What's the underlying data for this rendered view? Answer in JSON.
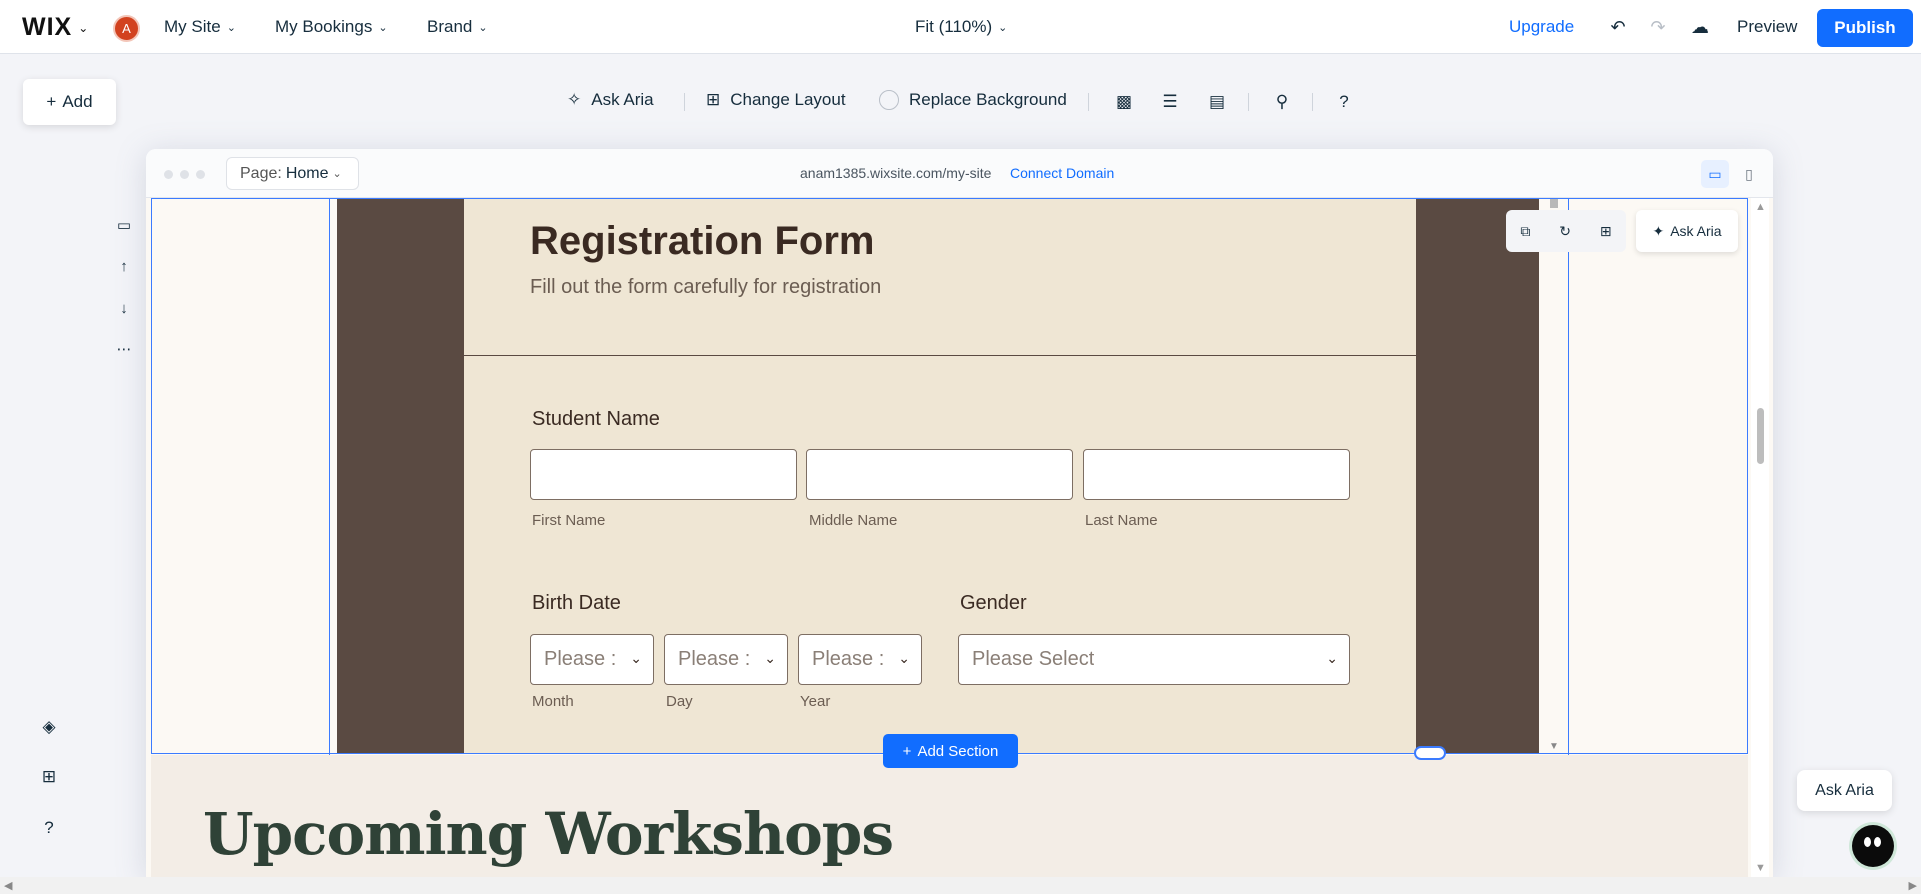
{
  "topbar": {
    "logo": "WIX",
    "avatar_letter": "A",
    "menus": [
      "My Site",
      "My Bookings",
      "Brand"
    ],
    "zoom": "Fit (110%)",
    "upgrade": "Upgrade",
    "preview": "Preview",
    "publish": "Publish"
  },
  "toolbar": {
    "add": "Add",
    "ask_aria": "Ask Aria",
    "change_layout": "Change Layout",
    "replace_background": "Replace Background",
    "help": "?"
  },
  "frame": {
    "page_prefix": "Page:",
    "page_name": "Home",
    "url": "anam1385.wixsite.com/my-site",
    "connect_domain": "Connect Domain"
  },
  "form": {
    "title": "Registration Form",
    "subtitle": "Fill out the form carefully for registration",
    "student_name_label": "Student Name",
    "first_name": "First Name",
    "middle_name": "Middle Name",
    "last_name": "Last Name",
    "birth_date_label": "Birth Date",
    "gender_label": "Gender",
    "month_placeholder": "Please :",
    "day_placeholder": "Please :",
    "year_placeholder": "Please :",
    "month": "Month",
    "day": "Day",
    "year": "Year",
    "gender_placeholder": "Please Select"
  },
  "canvas": {
    "ask_aria_mini": "Ask Aria",
    "add_section": "Add Section",
    "workshops_title": "Upcoming Workshops"
  },
  "aria_bubble": "Ask Aria",
  "colors": {
    "accent": "#116dff",
    "form_bg": "#efe6d4",
    "dark_bg": "#5a4a42",
    "heading": "#2f4237"
  }
}
